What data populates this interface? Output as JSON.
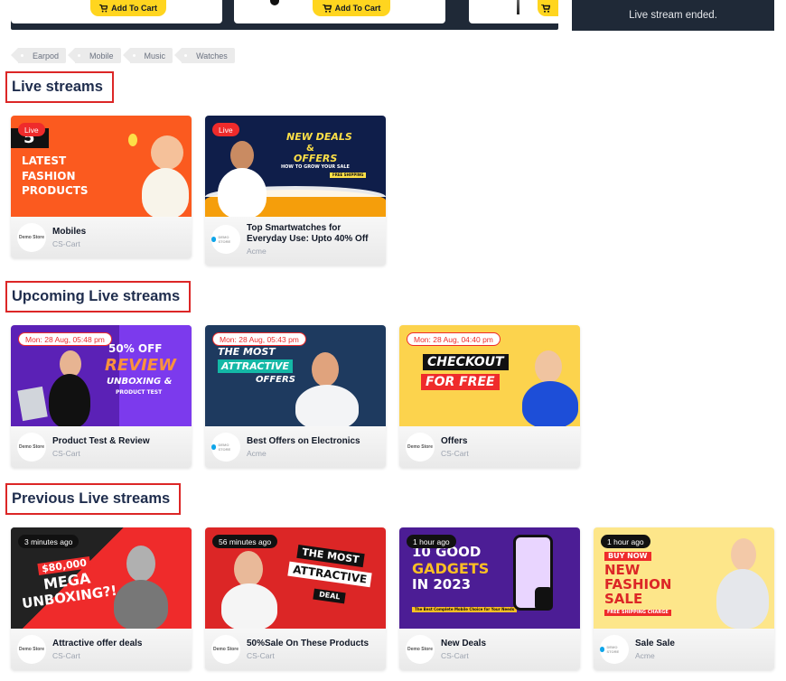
{
  "top_strip": {
    "add_to_cart_label": "Add To Cart",
    "stream_ended_text": "Live stream ended."
  },
  "tags": [
    "Earpod",
    "Mobile",
    "Music",
    "Watches"
  ],
  "sections": {
    "live": {
      "title": "Live streams",
      "cards": [
        {
          "badge": "Live",
          "title": "Mobiles",
          "vendor": "CS-Cart",
          "art_text": [
            "5",
            "LATEST",
            "FASHION",
            "PRODUCTS"
          ]
        },
        {
          "badge": "Live",
          "title": "Top Smartwatches for Everyday Use: Upto 40% Off",
          "vendor": "Acme",
          "art_text": [
            "NEW DEALS",
            "&",
            "OFFERS",
            "HOW TO GROW YOUR SALE",
            "FREE SHIPPING"
          ]
        }
      ]
    },
    "upcoming": {
      "title": "Upcoming Live streams",
      "cards": [
        {
          "badge": "Mon: 28 Aug, 05:48 pm",
          "title": "Product Test & Review",
          "vendor": "CS-Cart",
          "art_text": [
            "50% OFF",
            "REVIEW",
            "UNBOXING &",
            "PRODUCT TEST"
          ]
        },
        {
          "badge": "Mon: 28 Aug, 05:43 pm",
          "title": "Best Offers on Electronics",
          "vendor": "Acme",
          "art_text": [
            "THE MOST",
            "ATTRACTIVE",
            "OFFERS"
          ]
        },
        {
          "badge": "Mon: 28 Aug, 04:40 pm",
          "title": "Offers",
          "vendor": "CS-Cart",
          "art_text": [
            "CHECKOUT",
            "FOR FREE"
          ]
        }
      ]
    },
    "previous": {
      "title": "Previous Live streams",
      "cards": [
        {
          "badge": "3 minutes ago",
          "title": "Attractive offer deals",
          "vendor": "CS-Cart",
          "art_text": [
            "$80,000",
            "MEGA",
            "UNBOXING?!"
          ]
        },
        {
          "badge": "56 minutes ago",
          "title": "50%Sale On These Products",
          "vendor": "CS-Cart",
          "art_text": [
            "THE MOST",
            "ATTRACTIVE",
            "DEAL"
          ]
        },
        {
          "badge": "1 hour ago",
          "title": "New Deals",
          "vendor": "CS-Cart",
          "art_text": [
            "10 GOOD",
            "GADGETS",
            "IN 2023",
            "The Best Complete Mobile Choice for Your Needs"
          ]
        },
        {
          "badge": "1 hour ago",
          "title": "Sale Sale",
          "vendor": "Acme",
          "art_text": [
            "BUY NOW",
            "NEW",
            "FASHION",
            "SALE",
            "FREE SHIPPING CHARGE"
          ]
        }
      ]
    }
  },
  "store_logos": {
    "demo": "Demo Store",
    "acme": "DEMO STORE"
  },
  "colors": {
    "heading": "#1f2d4d",
    "highlight_border": "#dc2626",
    "live_badge": "#ef2b2b",
    "cart_button": "#ffd51f",
    "dark_panel": "#1f2937"
  }
}
